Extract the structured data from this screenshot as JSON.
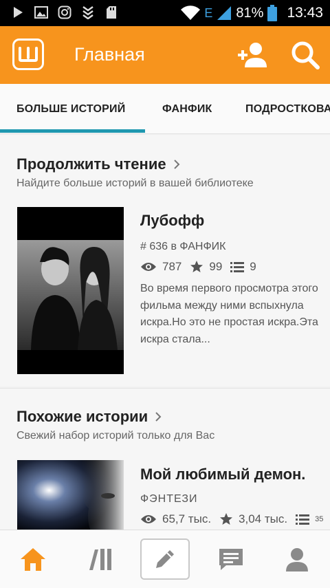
{
  "status_bar": {
    "network_label": "E",
    "battery": "81%",
    "time": "13:43"
  },
  "app_bar": {
    "title": "Главная"
  },
  "tabs": [
    {
      "label": "БОЛЬШЕ ИСТОРИЙ",
      "selected": true
    },
    {
      "label": "ФАНФИК",
      "selected": false
    },
    {
      "label": "ПОДРОСТКОВАЯ",
      "selected": false
    }
  ],
  "continue_reading": {
    "title": "Продолжить чтение",
    "subtitle": "Найдите больше историй в вашей библиотеке",
    "story": {
      "title": "Лубофф",
      "rank": "# 636 в ФАНФИК",
      "views": "787",
      "votes": "99",
      "parts": "9",
      "description": "Во время первого просмотра этого фильма между ними вспыхнула искра.Но это не простая искра.Эта искра стала..."
    }
  },
  "similar_stories": {
    "title": "Похожие истории",
    "subtitle": "Свежий набор историй только для Вас",
    "story": {
      "title": "Мой любимый демон.",
      "genre": "ФЭНТЕЗИ",
      "views": "65,7 тыс.",
      "votes": "3,04 тыс.",
      "parts": "35"
    }
  },
  "colors": {
    "accent": "#f7941d",
    "tab_indicator": "#1f98b0",
    "active_nav": "#f7941d",
    "inactive_nav": "#8a8a8a"
  },
  "icons": {
    "status": [
      "play-icon",
      "image-icon",
      "instagram-icon",
      "download-icon",
      "sd-card-icon",
      "wifi-icon",
      "signal-icon",
      "battery-icon"
    ],
    "app_bar": [
      "wattpad-logo-icon",
      "add-user-icon",
      "search-icon"
    ],
    "bottom_nav": [
      "home-icon",
      "library-icon",
      "write-icon",
      "messages-icon",
      "profile-icon"
    ]
  }
}
